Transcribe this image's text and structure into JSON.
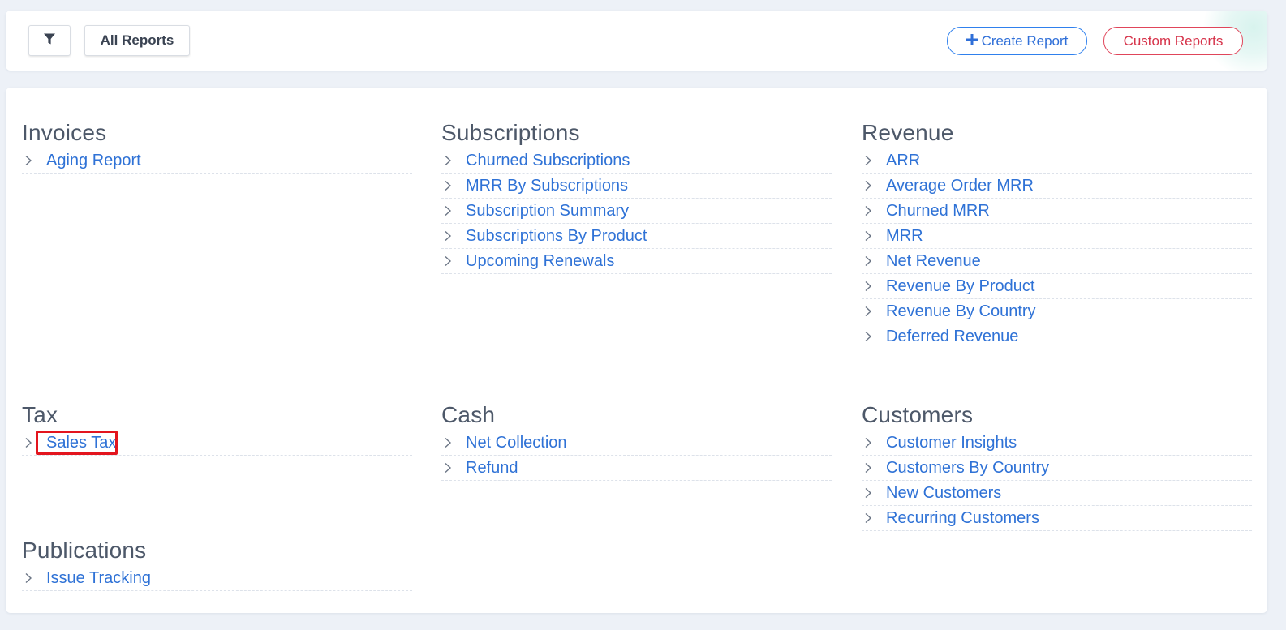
{
  "toolbar": {
    "filter_icon": "filter-icon",
    "all_reports_label": "All Reports",
    "create_report_label": "Create Report",
    "create_report_icon": "plus-icon",
    "custom_reports_label": "Custom Reports"
  },
  "colors": {
    "link": "#2f72d6",
    "heading": "#4d5869",
    "create_accent": "#2f80ed",
    "custom_accent": "#d6334a",
    "highlight": "#e3151e"
  },
  "sections": {
    "invoices": {
      "title": "Invoices",
      "items": [
        "Aging Report"
      ]
    },
    "subscriptions": {
      "title": "Subscriptions",
      "items": [
        "Churned Subscriptions",
        "MRR By Subscriptions",
        "Subscription Summary",
        "Subscriptions By Product",
        "Upcoming Renewals"
      ]
    },
    "revenue": {
      "title": "Revenue",
      "items": [
        "ARR",
        "Average Order MRR",
        "Churned MRR",
        "MRR",
        "Net Revenue",
        "Revenue By Product",
        "Revenue By Country",
        "Deferred Revenue"
      ]
    },
    "tax": {
      "title": "Tax",
      "items": [
        "Sales Tax"
      ]
    },
    "cash": {
      "title": "Cash",
      "items": [
        "Net Collection",
        "Refund"
      ]
    },
    "customers": {
      "title": "Customers",
      "items": [
        "Customer Insights",
        "Customers By Country",
        "New Customers",
        "Recurring Customers"
      ]
    },
    "publications": {
      "title": "Publications",
      "items": [
        "Issue Tracking"
      ]
    }
  },
  "item_icon": "chevron-right-icon",
  "highlighted_item": "Sales Tax"
}
